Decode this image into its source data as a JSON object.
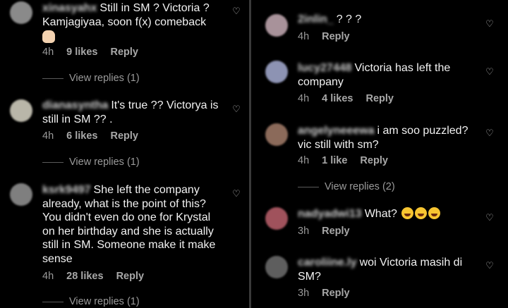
{
  "left": {
    "c1": {
      "username": "xinasyahx",
      "text": "Still in SM ? Victoria ? Kamjagiyaa, soon f(x) comeback",
      "time": "4h",
      "likes": "9 likes",
      "reply": "Reply",
      "view_replies": "View replies (1)",
      "avatar_color": "#8a8a8a"
    },
    "c2": {
      "username": "dianasyntha",
      "text": "It's true ?? Victorya is still in SM ?? .",
      "time": "4h",
      "likes": "6 likes",
      "reply": "Reply",
      "view_replies": "View replies (1)",
      "avatar_color": "#b9b6a9"
    },
    "c3": {
      "username": "ksrk9497",
      "text": "She left the company already, what is the point of this? You didn't even do one for Krystal on her birthday and she is actually still in SM. Someone make it make sense",
      "time": "4h",
      "likes": "28 likes",
      "reply": "Reply",
      "view_replies": "View replies (1)",
      "avatar_color": "#7f7f7f"
    }
  },
  "right": {
    "c1": {
      "username": "2inlin_",
      "text": "? ? ?",
      "time": "4h",
      "reply": "Reply",
      "avatar_color": "#a8929a"
    },
    "c2": {
      "username": "lucy27448",
      "text": "Victoria has left the company",
      "time": "4h",
      "likes": "4 likes",
      "reply": "Reply",
      "avatar_color": "#8d93b3"
    },
    "c3": {
      "username": "angelyneeewa",
      "text": "i am soo puzzled? vic still with sm?",
      "time": "4h",
      "likes": "1 like",
      "reply": "Reply",
      "view_replies": "View replies (2)",
      "avatar_color": "#8b6a5a"
    },
    "c4": {
      "username": "nadyadwi13",
      "text": "What?",
      "time": "3h",
      "reply": "Reply",
      "avatar_color": "#a0525c"
    },
    "c5": {
      "username": "caroliine.ly",
      "text": "woi Victoria masih di SM?",
      "time": "3h",
      "reply": "Reply",
      "avatar_color": "#5e5e5e"
    }
  },
  "icons": {
    "heart": "heart-icon",
    "hands": "raising-hands-emoji",
    "laugh": "tears-of-joy-emoji"
  }
}
